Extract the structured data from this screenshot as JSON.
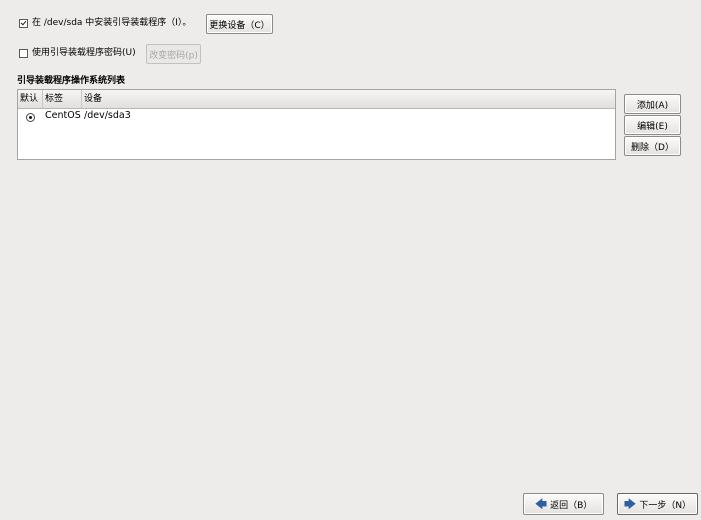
{
  "install_loader": {
    "checked": true,
    "label": "在 /dev/sda 中安装引导装载程序（I）。",
    "change_device_button": "更换设备（C）"
  },
  "password": {
    "checked": false,
    "label": "使用引导装载程序密码(U)",
    "change_password_button": "改变密码(p)"
  },
  "os_list": {
    "title": "引导装载程序操作系统列表",
    "columns": [
      "默认",
      "标签",
      "设备"
    ],
    "rows": [
      {
        "default": true,
        "label": "CentOS",
        "device": "/dev/sda3"
      }
    ]
  },
  "side_buttons": {
    "add": "添加(A)",
    "edit": "编辑(E)",
    "delete": "删除（D）"
  },
  "footer": {
    "back": "返回（B）",
    "next": "下一步（N）"
  },
  "colors": {
    "background": "#edeceb",
    "arrow": "#2e5fa3"
  }
}
